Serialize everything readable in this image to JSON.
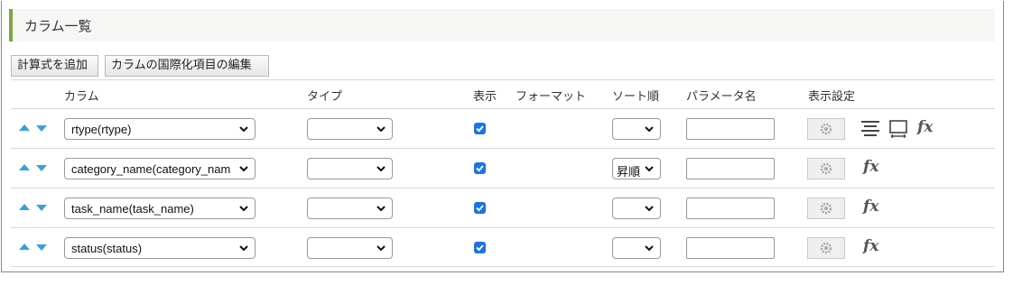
{
  "header": {
    "title": "カラム一覧"
  },
  "toolbar": {
    "add_formula_label": "計算式を追加",
    "i18n_edit_label": "カラムの国際化項目の編集"
  },
  "table": {
    "headers": {
      "column": "カラム",
      "type": "タイプ",
      "display": "表示",
      "format": "フォーマット",
      "sort": "ソート順",
      "param": "パラメータ名",
      "display_settings": "表示設定"
    },
    "rows": [
      {
        "column": "rtype(rtype)",
        "type": "",
        "display": true,
        "sort": "",
        "param": "",
        "icons": [
          "gear-icon",
          "align-center-icon",
          "display-icon",
          "fx-icon"
        ]
      },
      {
        "column": "category_name(category_nam",
        "type": "",
        "display": true,
        "sort": "昇順",
        "param": "",
        "icons": [
          "gear-icon",
          "fx-icon"
        ]
      },
      {
        "column": "task_name(task_name)",
        "type": "",
        "display": true,
        "sort": "",
        "param": "",
        "icons": [
          "gear-icon",
          "fx-icon"
        ]
      },
      {
        "column": "status(status)",
        "type": "",
        "display": true,
        "sort": "",
        "param": "",
        "icons": [
          "gear-icon",
          "fx-icon"
        ]
      }
    ]
  },
  "fx_label": "fx",
  "colors": {
    "accent": "#7ca642",
    "arrow": "#3aa0dc",
    "checkbox": "#1a73e8"
  }
}
